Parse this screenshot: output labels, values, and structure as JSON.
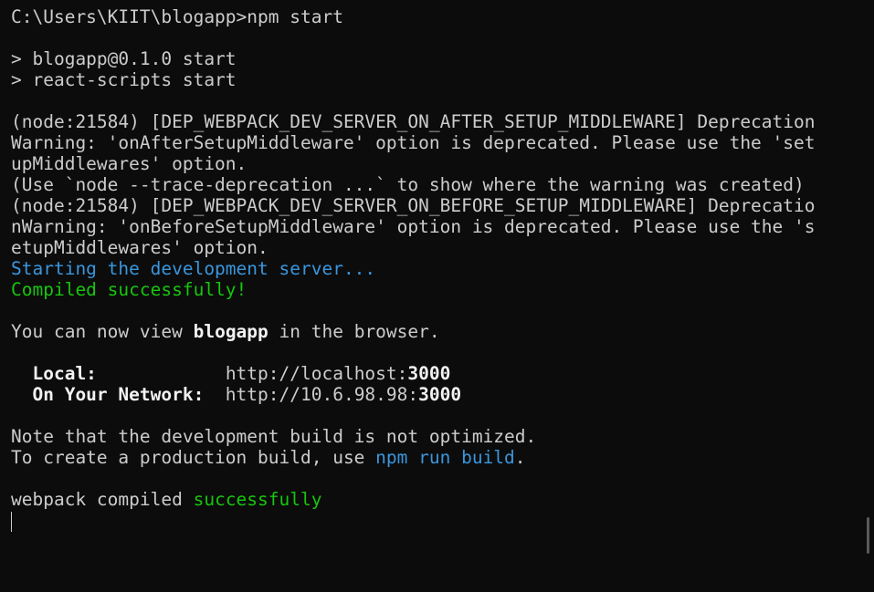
{
  "terminal": {
    "lines": [
      {
        "segments": [
          {
            "text": "C:\\Users\\KIIT\\blogapp>npm start",
            "style": "normal"
          }
        ]
      },
      {
        "segments": []
      },
      {
        "segments": [
          {
            "text": "> blogapp@0.1.0 start",
            "style": "normal"
          }
        ]
      },
      {
        "segments": [
          {
            "text": "> react-scripts start",
            "style": "normal"
          }
        ]
      },
      {
        "segments": []
      },
      {
        "segments": [
          {
            "text": "(node:21584) [DEP_WEBPACK_DEV_SERVER_ON_AFTER_SETUP_MIDDLEWARE] Deprecation",
            "style": "normal"
          }
        ]
      },
      {
        "segments": [
          {
            "text": "Warning: 'onAfterSetupMiddleware' option is deprecated. Please use the 'set",
            "style": "normal"
          }
        ]
      },
      {
        "segments": [
          {
            "text": "upMiddlewares' option.",
            "style": "normal"
          }
        ]
      },
      {
        "segments": [
          {
            "text": "(Use `node --trace-deprecation ...` to show where the warning was created)",
            "style": "normal"
          }
        ]
      },
      {
        "segments": [
          {
            "text": "(node:21584) [DEP_WEBPACK_DEV_SERVER_ON_BEFORE_SETUP_MIDDLEWARE] Deprecatio",
            "style": "normal"
          }
        ]
      },
      {
        "segments": [
          {
            "text": "nWarning: 'onBeforeSetupMiddleware' option is deprecated. Please use the 's",
            "style": "normal"
          }
        ]
      },
      {
        "segments": [
          {
            "text": "etupMiddlewares' option.",
            "style": "normal"
          }
        ]
      },
      {
        "segments": [
          {
            "text": "Starting the development server...",
            "style": "blue"
          }
        ]
      },
      {
        "segments": [
          {
            "text": "Compiled successfully!",
            "style": "green"
          }
        ]
      },
      {
        "segments": []
      },
      {
        "segments": [
          {
            "text": "You can now view ",
            "style": "normal"
          },
          {
            "text": "blogapp",
            "style": "bright"
          },
          {
            "text": " in the browser.",
            "style": "normal"
          }
        ]
      },
      {
        "segments": []
      },
      {
        "segments": [
          {
            "text": "  ",
            "style": "normal"
          },
          {
            "text": "Local:",
            "style": "bright"
          },
          {
            "text": "            http://localhost:",
            "style": "normal"
          },
          {
            "text": "3000",
            "style": "bright"
          }
        ]
      },
      {
        "segments": [
          {
            "text": "  ",
            "style": "normal"
          },
          {
            "text": "On Your Network:",
            "style": "bright"
          },
          {
            "text": "  http://10.6.98.98:",
            "style": "normal"
          },
          {
            "text": "3000",
            "style": "bright"
          }
        ]
      },
      {
        "segments": []
      },
      {
        "segments": [
          {
            "text": "Note that the development build is not optimized.",
            "style": "normal"
          }
        ]
      },
      {
        "segments": [
          {
            "text": "To create a production build, use ",
            "style": "normal"
          },
          {
            "text": "npm run build",
            "style": "blue"
          },
          {
            "text": ".",
            "style": "normal"
          }
        ]
      },
      {
        "segments": []
      },
      {
        "segments": [
          {
            "text": "webpack compiled ",
            "style": "normal"
          },
          {
            "text": "successfully",
            "style": "green"
          }
        ]
      }
    ]
  },
  "colors": {
    "background": "#0c0c0c",
    "foreground": "#cccccc",
    "bright": "#f2f2f2",
    "blue": "#3a96dd",
    "green": "#16c60c"
  }
}
